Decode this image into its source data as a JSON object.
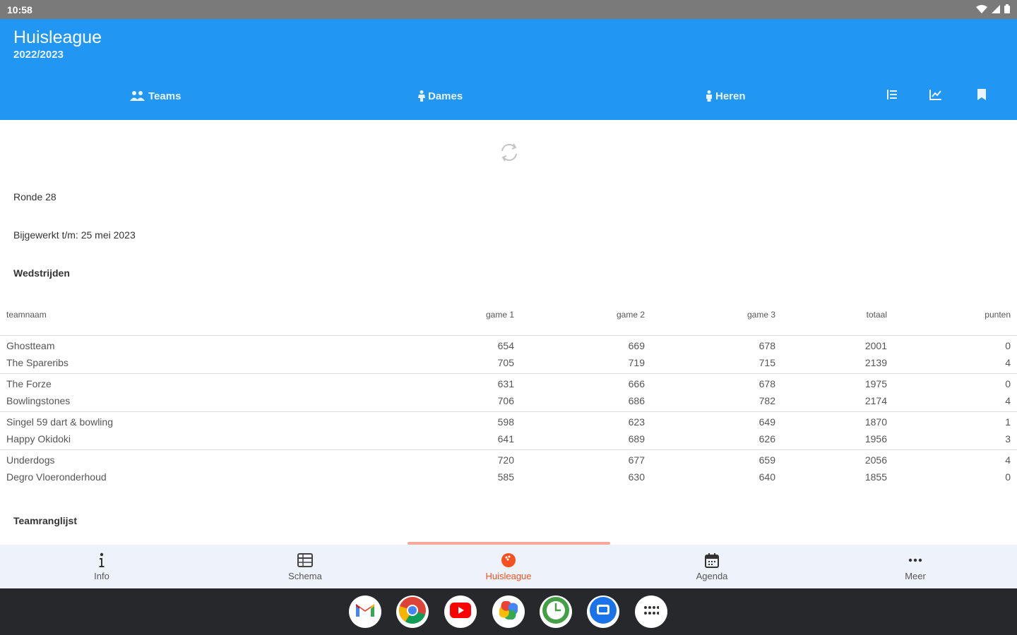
{
  "status": {
    "time": "10:58"
  },
  "app": {
    "title": "Huisleague",
    "season": "2022/2023"
  },
  "tabs": [
    {
      "label": "Teams",
      "icon": "people-icon"
    },
    {
      "label": "Dames",
      "icon": "female-icon"
    },
    {
      "label": "Heren",
      "icon": "male-icon"
    }
  ],
  "actions": [
    "list-icon",
    "chart-icon",
    "bookmark-icon"
  ],
  "content": {
    "round": "Ronde 28",
    "updated": "Bijgewerkt t/m: 25 mei 2023",
    "matches_heading": "Wedstrijden",
    "ranking_heading": "Teamranglijst"
  },
  "table": {
    "headers": [
      "teamnaam",
      "game 1",
      "game 2",
      "game 3",
      "totaal",
      "punten"
    ],
    "matches": [
      [
        {
          "team": "Ghostteam",
          "g1": "654",
          "g2": "669",
          "g3": "678",
          "total": "2001",
          "points": "0"
        },
        {
          "team": "The Spareribs",
          "g1": "705",
          "g2": "719",
          "g3": "715",
          "total": "2139",
          "points": "4"
        }
      ],
      [
        {
          "team": "The Forze",
          "g1": "631",
          "g2": "666",
          "g3": "678",
          "total": "1975",
          "points": "0"
        },
        {
          "team": "Bowlingstones",
          "g1": "706",
          "g2": "686",
          "g3": "782",
          "total": "2174",
          "points": "4"
        }
      ],
      [
        {
          "team": "Singel 59 dart & bowling",
          "g1": "598",
          "g2": "623",
          "g3": "649",
          "total": "1870",
          "points": "1"
        },
        {
          "team": "Happy Okidoki",
          "g1": "641",
          "g2": "689",
          "g3": "626",
          "total": "1956",
          "points": "3"
        }
      ],
      [
        {
          "team": "Underdogs",
          "g1": "720",
          "g2": "677",
          "g3": "659",
          "total": "2056",
          "points": "4"
        },
        {
          "team": "Degro Vloeronderhoud",
          "g1": "585",
          "g2": "630",
          "g3": "640",
          "total": "1855",
          "points": "0"
        }
      ]
    ]
  },
  "bottom_nav": [
    {
      "label": "Info",
      "icon": "info-icon",
      "active": false
    },
    {
      "label": "Schema",
      "icon": "table-icon",
      "active": false
    },
    {
      "label": "Huisleague",
      "icon": "bowling-ball-icon",
      "active": true
    },
    {
      "label": "Agenda",
      "icon": "calendar-icon",
      "active": false
    },
    {
      "label": "Meer",
      "icon": "more-icon",
      "active": false
    }
  ],
  "dock": [
    "gmail-icon",
    "chrome-icon",
    "youtube-icon",
    "photos-icon",
    "clock-app-icon",
    "messages-icon",
    "app-drawer-icon"
  ],
  "colors": {
    "primary": "#2196f3",
    "accent": "#f4511e",
    "status_bar": "#7a7a7a",
    "dock": "#27282c"
  }
}
